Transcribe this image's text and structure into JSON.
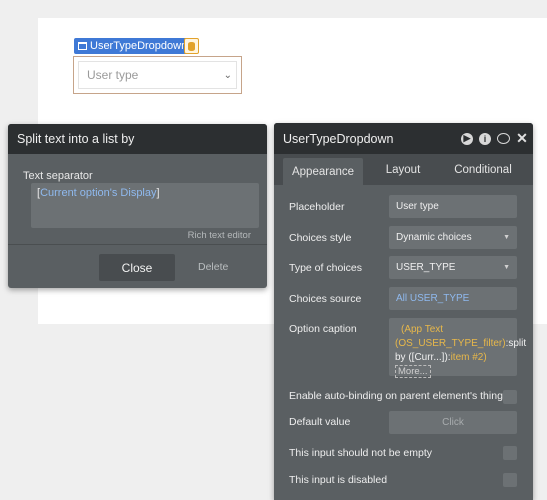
{
  "canvas": {
    "element_tag": "UserTypeDropdown",
    "dropdown_placeholder": "User type"
  },
  "split_panel": {
    "title": "Split text into a list by",
    "separator_label": "Text separator",
    "separator_open": "[",
    "separator_dynamic": "Current option's Display",
    "separator_close": "]",
    "rich_text_editor": "Rich text editor",
    "close_label": "Close",
    "delete_label": "Delete"
  },
  "properties": {
    "title": "UserTypeDropdown",
    "tabs": [
      "Appearance",
      "Layout",
      "Conditional"
    ],
    "rows": {
      "placeholder_label": "Placeholder",
      "placeholder_value": "User type",
      "choices_style_label": "Choices style",
      "choices_style_value": "Dynamic choices",
      "type_label": "Type of choices",
      "type_value": "USER_TYPE",
      "source_label": "Choices source",
      "source_value": "All USER_TYPE",
      "caption_label": "Option caption",
      "caption_part1": "(App Text",
      "caption_part2": "(OS_USER_TYPE_filter)",
      "caption_part3": ":split by ([Curr...]):",
      "caption_part4": "item",
      "caption_part5": "#2)",
      "caption_more": "More...",
      "autobinding_label": "Enable auto-binding on parent element's thing",
      "default_label": "Default value",
      "default_placeholder": "Click",
      "not_empty_label": "This input should not be empty",
      "disabled_label": "This input is disabled"
    }
  },
  "colors": {
    "tag_blue": "#3f79d6",
    "panel_bg": "#5a5f62",
    "header_bg": "#2c2f31",
    "dynamic_blue": "#8fb9ee",
    "operator_orange": "#e8b84a"
  }
}
